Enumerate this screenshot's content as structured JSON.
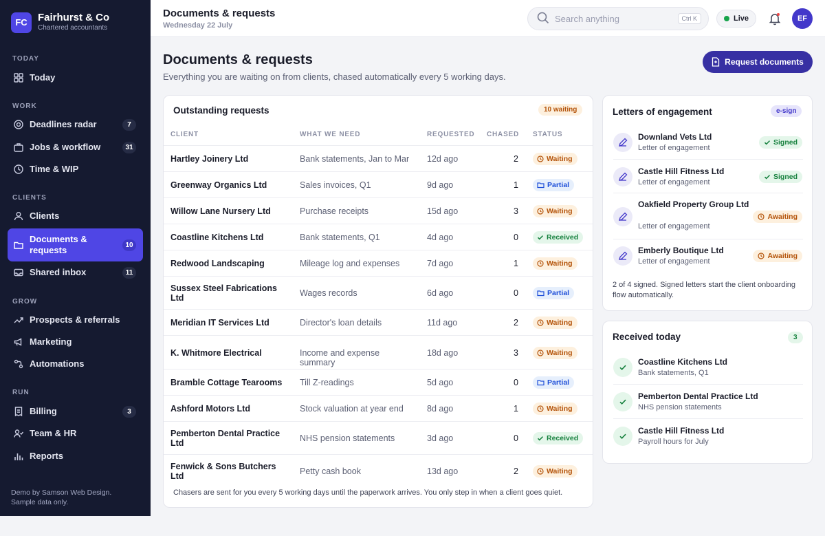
{
  "brand": {
    "initials": "FC",
    "name": "Fairhurst & Co",
    "subtitle": "Chartered accountants"
  },
  "nav": {
    "sections": {
      "today": "TODAY",
      "work": "WORK",
      "clients": "CLIENTS",
      "grow": "GROW",
      "run": "RUN"
    },
    "items": [
      {
        "label": "Today",
        "icon": "grid-icon"
      },
      {
        "label": "Deadlines radar",
        "icon": "radar-icon",
        "badge": "7"
      },
      {
        "label": "Jobs & workflow",
        "icon": "briefcase-icon",
        "badge": "31"
      },
      {
        "label": "Time & WIP",
        "icon": "clock-icon"
      },
      {
        "label": "Clients",
        "icon": "users-icon"
      },
      {
        "label": "Documents & requests",
        "icon": "folder-icon",
        "badge": "10",
        "active": true
      },
      {
        "label": "Shared inbox",
        "icon": "inbox-icon",
        "badge": "11"
      },
      {
        "label": "Prospects & referrals",
        "icon": "trend-icon"
      },
      {
        "label": "Marketing",
        "icon": "megaphone-icon"
      },
      {
        "label": "Automations",
        "icon": "automation-icon"
      },
      {
        "label": "Billing",
        "icon": "receipt-icon",
        "badge": "3"
      },
      {
        "label": "Team & HR",
        "icon": "team-icon"
      },
      {
        "label": "Reports",
        "icon": "chart-icon"
      }
    ],
    "footer_line1": "Demo by Samson Web Design.",
    "footer_line2": "Sample data only."
  },
  "topbar": {
    "title": "Documents & requests",
    "date": "Wednesday 22 July",
    "search_placeholder": "Search anything",
    "shortcut": "Ctrl K",
    "live_label": "Live",
    "avatar": "EF"
  },
  "page": {
    "title": "Documents & requests",
    "subtitle": "Everything you are waiting on from clients, chased automatically every 5 working days.",
    "request_button": "Request documents"
  },
  "outstanding": {
    "title": "Outstanding requests",
    "count_pill": "10 waiting",
    "columns": [
      "CLIENT",
      "WHAT WE NEED",
      "REQUESTED",
      "CHASED",
      "STATUS"
    ],
    "rows": [
      {
        "client": "Hartley Joinery Ltd",
        "need": "Bank statements, Jan to Mar",
        "requested": "12d ago",
        "chased": "2",
        "status": "Waiting"
      },
      {
        "client": "Greenway Organics Ltd",
        "need": "Sales invoices, Q1",
        "requested": "9d ago",
        "chased": "1",
        "status": "Partial"
      },
      {
        "client": "Willow Lane Nursery Ltd",
        "need": "Purchase receipts",
        "requested": "15d ago",
        "chased": "3",
        "status": "Waiting"
      },
      {
        "client": "Coastline Kitchens Ltd",
        "need": "Bank statements, Q1",
        "requested": "4d ago",
        "chased": "0",
        "status": "Received"
      },
      {
        "client": "Redwood Landscaping",
        "need": "Mileage log and expenses",
        "requested": "7d ago",
        "chased": "1",
        "status": "Waiting"
      },
      {
        "client": "Sussex Steel Fabrications Ltd",
        "need": "Wages records",
        "requested": "6d ago",
        "chased": "0",
        "status": "Partial"
      },
      {
        "client": "Meridian IT Services Ltd",
        "need": "Director's loan details",
        "requested": "11d ago",
        "chased": "2",
        "status": "Waiting"
      },
      {
        "client": "K. Whitmore Electrical",
        "need": "Income and expense summary",
        "requested": "18d ago",
        "chased": "3",
        "status": "Waiting"
      },
      {
        "client": "Bramble Cottage Tearooms",
        "need": "Till Z-readings",
        "requested": "5d ago",
        "chased": "0",
        "status": "Partial"
      },
      {
        "client": "Ashford Motors Ltd",
        "need": "Stock valuation at year end",
        "requested": "8d ago",
        "chased": "1",
        "status": "Waiting"
      },
      {
        "client": "Pemberton Dental Practice Ltd",
        "need": "NHS pension statements",
        "requested": "3d ago",
        "chased": "0",
        "status": "Received"
      },
      {
        "client": "Fenwick & Sons Butchers Ltd",
        "need": "Petty cash book",
        "requested": "13d ago",
        "chased": "2",
        "status": "Waiting"
      }
    ],
    "footer": "Chasers are sent for you every 5 working days until the paperwork arrives. You only step in when a client goes quiet."
  },
  "engagement": {
    "title": "Letters of engagement",
    "pill": "e-sign",
    "items": [
      {
        "name": "Downland Vets Ltd",
        "sub": "Letter of engagement",
        "status": "Signed"
      },
      {
        "name": "Castle Hill Fitness Ltd",
        "sub": "Letter of engagement",
        "status": "Signed"
      },
      {
        "name": "Oakfield Property Group Ltd",
        "sub": "Letter of engagement",
        "status": "Awaiting"
      },
      {
        "name": "Emberly Boutique Ltd",
        "sub": "Letter of engagement",
        "status": "Awaiting"
      }
    ],
    "note": "2 of 4 signed. Signed letters start the client onboarding flow automatically."
  },
  "received": {
    "title": "Received today",
    "count": "3",
    "items": [
      {
        "name": "Coastline Kitchens Ltd",
        "sub": "Bank statements, Q1"
      },
      {
        "name": "Pemberton Dental Practice Ltd",
        "sub": "NHS pension statements"
      },
      {
        "name": "Castle Hill Fitness Ltd",
        "sub": "Payroll hours for July"
      }
    ]
  },
  "colors": {
    "sidebar": "#151a30",
    "accent": "#4f46e5",
    "button": "#3730a3",
    "waiting": "#b45309",
    "partial": "#1d4ed8",
    "received": "#15803d"
  }
}
